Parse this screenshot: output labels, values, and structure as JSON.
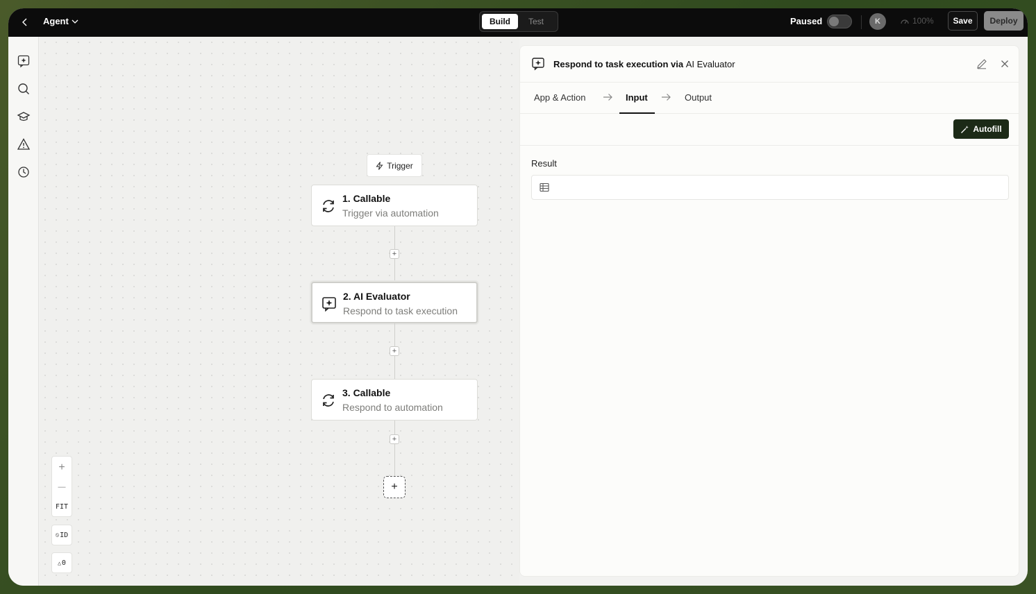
{
  "topbar": {
    "agent_label": "Agent",
    "mode_tabs": [
      "Build",
      "Test"
    ],
    "status_label": "Paused",
    "status_toggle_on": false,
    "avatar_initial": "K",
    "zoom_label": "100%",
    "save_label": "Save",
    "deploy_label": "Deploy"
  },
  "sidebar": {
    "icons": [
      "ai-sparkle-icon",
      "search-icon",
      "education-icon",
      "warning-icon",
      "history-icon"
    ]
  },
  "canvas": {
    "trigger_label": "Trigger",
    "nodes": [
      {
        "title": "1. Callable",
        "subtitle": "Trigger via automation",
        "icon": "sync-icon"
      },
      {
        "title": "2. AI Evaluator",
        "subtitle": "Respond to task execution",
        "icon": "ai-chat-icon",
        "selected": true
      },
      {
        "title": "3. Callable",
        "subtitle": "Respond to automation",
        "icon": "sync-icon"
      }
    ],
    "zoom_controls": {
      "zoom_in": "+",
      "zoom_out": "—",
      "fit": "FIT"
    },
    "id_toggle": "ID",
    "warnings_count": "0"
  },
  "panel": {
    "title_main": "Respond to task execution via",
    "title_app": "AI Evaluator",
    "tabs": [
      "App & Action",
      "Input",
      "Output"
    ],
    "active_tab": "Input",
    "autofill_label": "Autofill",
    "result_label": "Result",
    "result_value": ""
  },
  "colors": {
    "topbar_bg": "#0c0c0c",
    "autofill_bg": "#1c2a17",
    "canvas_bg": "#f0f0ee"
  }
}
